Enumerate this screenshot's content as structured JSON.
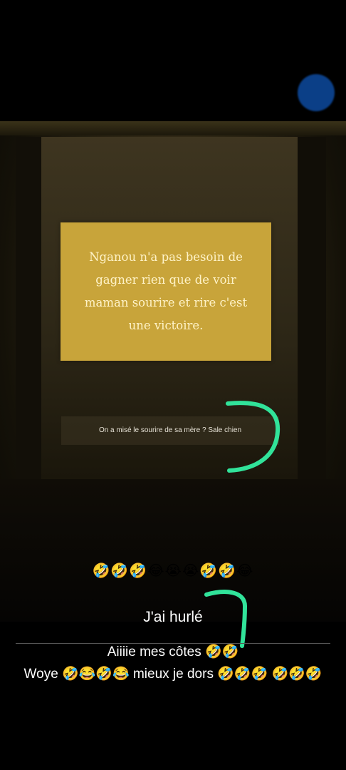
{
  "quote_card": {
    "text": "Nganou n'a pas besoin de gagner rien que de voir maman sourire et rire c'est une victoire."
  },
  "comment": {
    "text": "On a misé le sourire de sa mère ? Sale chien"
  },
  "emoji_row": "🤣🤣🤣😂😭😭🤣🤣😂",
  "captions": {
    "line1": "J'ai hurlé",
    "line2": "Aiiiie mes côtes 🤣🤣",
    "line3": "Woye 🤣😂🤣😂 mieux je dors 🤣🤣🤣 🤣🤣🤣"
  },
  "colors": {
    "annotation": "#31e39a",
    "card": "#c8a43a",
    "indicator_dot": "#0b3f87"
  }
}
